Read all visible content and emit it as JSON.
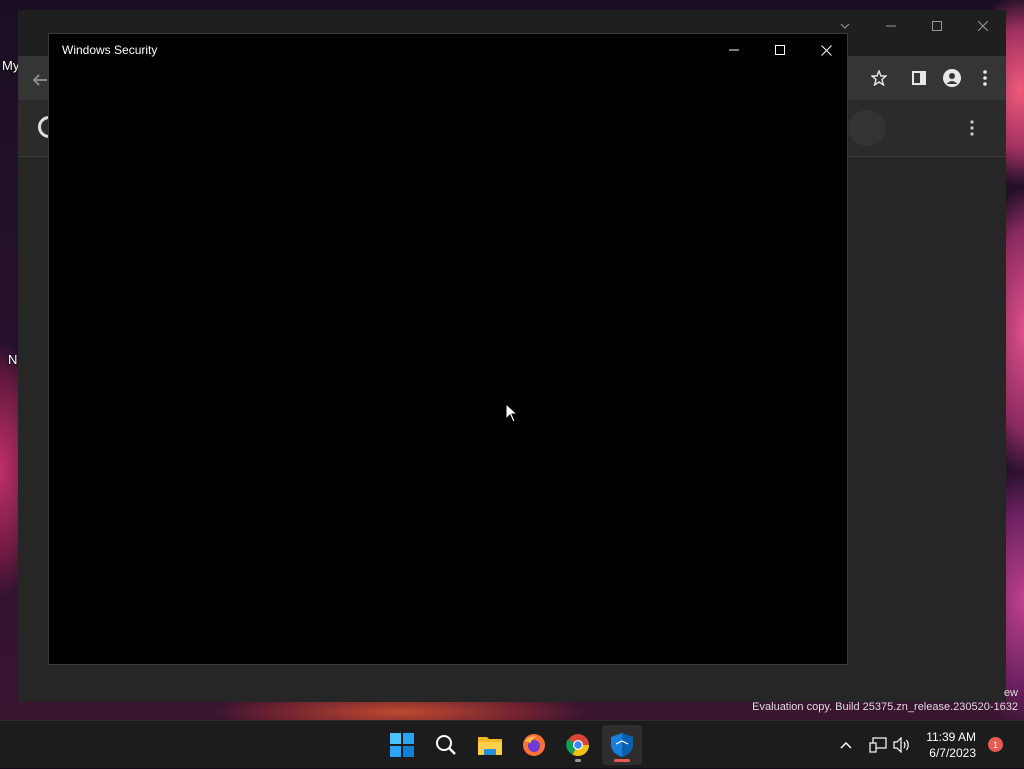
{
  "desktop": {
    "labels": [
      "My",
      "N"
    ]
  },
  "dialog": {
    "title": "Windows Security",
    "minimize_label": "Minimize",
    "maximize_label": "Maximize",
    "close_label": "Close"
  },
  "watermark": {
    "line1": "ew",
    "line2": "Evaluation copy. Build 25375.zn_release.230520-1632"
  },
  "taskbar": {
    "apps": [
      "start-icon",
      "search-icon",
      "file-explorer-icon",
      "firefox-icon",
      "chrome-icon",
      "windows-security-icon"
    ],
    "time": "11:39 AM",
    "date": "6/7/2023",
    "notification_count": "1"
  },
  "colors": {
    "accent": "#0078d4",
    "security_indicator": "#e85a4f",
    "chrome_indicator": "#9a9a9a"
  }
}
